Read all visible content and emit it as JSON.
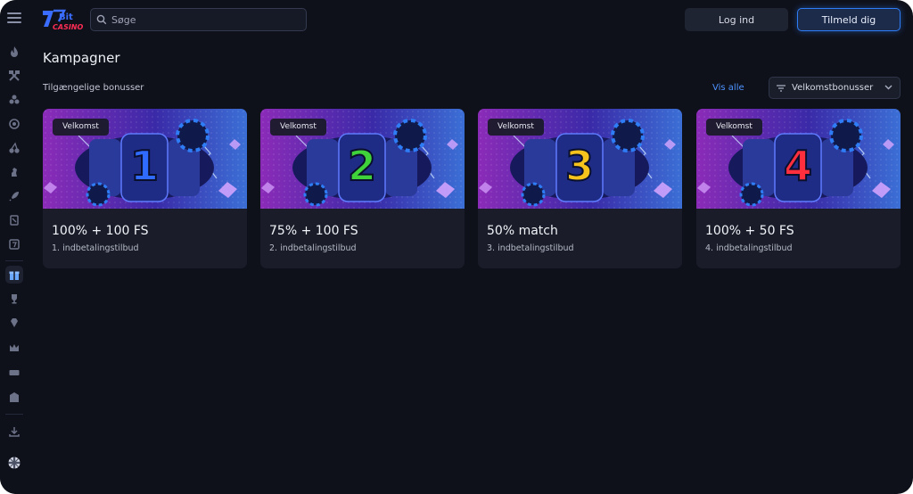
{
  "search": {
    "placeholder": "Søge"
  },
  "header": {
    "login_label": "Log ind",
    "signup_label": "Tilmeld dig"
  },
  "main": {
    "title": "Kampagner",
    "section_label": "Tilgængelige bonusser",
    "see_all_label": "Vis alle",
    "filter_label": "Velkomstbonusser"
  },
  "cards": [
    {
      "tag": "Velkomst",
      "number": "1",
      "title": "100% + 100 FS",
      "subtitle": "1. indbetalingstilbud",
      "number_color": "#2f6bff"
    },
    {
      "tag": "Velkomst",
      "number": "2",
      "title": "75% + 100 FS",
      "subtitle": "2. indbetalingstilbud",
      "number_color": "#3fd23a"
    },
    {
      "tag": "Velkomst",
      "number": "3",
      "title": "50% match",
      "subtitle": "3. indbetalingstilbud",
      "number_color": "#f6c21c"
    },
    {
      "tag": "Velkomst",
      "number": "4",
      "title": "100% + 50 FS",
      "subtitle": "4. indbetalingstilbud",
      "number_color": "#ff2f3d"
    }
  ],
  "sidebar": {
    "icons": [
      "menu-icon",
      "fire-icon",
      "crossed-tools-icon",
      "flame-cluster-icon",
      "target-icon",
      "cherries-icon",
      "chess-piece-icon",
      "rocket-icon",
      "cards-icon",
      "gift-icon",
      "trophy-icon",
      "gem-icon",
      "crown-icon",
      "ticket-icon",
      "mail-icon",
      "download-icon",
      "uk-flag-icon"
    ]
  },
  "colors": {
    "accent": "#2f7df6",
    "background": "#0f111a",
    "card": "#1a1d29"
  }
}
